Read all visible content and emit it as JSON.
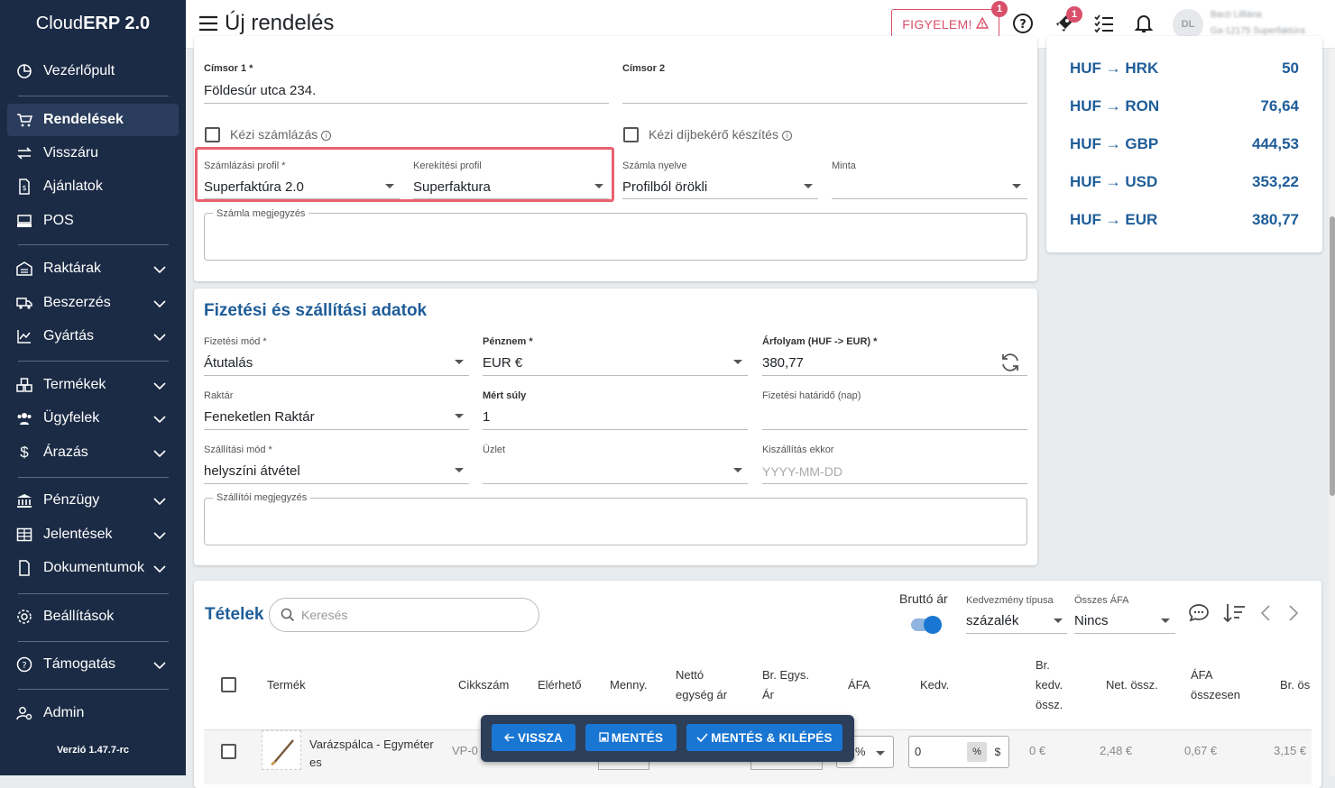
{
  "app": {
    "brand_prefix": "Cloud",
    "brand_bold": "ERP 2.0",
    "version": "Verzió 1.47.7-rc"
  },
  "sidebar": {
    "items": [
      {
        "label": "Vezérlőpult",
        "icon": "dashboard-icon"
      },
      {
        "label": "Rendelések",
        "icon": "cart-icon",
        "active": true
      },
      {
        "label": "Visszáru",
        "icon": "swap-icon"
      },
      {
        "label": "Ajánlatok",
        "icon": "document-dollar-icon"
      },
      {
        "label": "POS",
        "icon": "pos-icon"
      },
      {
        "label": "Raktárak",
        "icon": "warehouse-icon"
      },
      {
        "label": "Beszerzés",
        "icon": "truck-icon"
      },
      {
        "label": "Gyártás",
        "icon": "chart-icon"
      },
      {
        "label": "Termékek",
        "icon": "boxes-icon"
      },
      {
        "label": "Ügyfelek",
        "icon": "users-icon"
      },
      {
        "label": "Árazás",
        "icon": "dollar-icon"
      },
      {
        "label": "Pénzügy",
        "icon": "bank-icon"
      },
      {
        "label": "Jelentések",
        "icon": "table-icon"
      },
      {
        "label": "Dokumentumok",
        "icon": "file-icon"
      },
      {
        "label": "Beállítások",
        "icon": "gear-icon"
      },
      {
        "label": "Támogatás",
        "icon": "help-icon"
      },
      {
        "label": "Admin",
        "icon": "admin-icon"
      }
    ]
  },
  "header": {
    "title": "Új rendelés",
    "warning_label": "FIGYELEM!",
    "warning_badge": "1",
    "rocket_badge": "1",
    "avatar_initials": "DL",
    "user_name": "Barzi Lilliána",
    "user_sub": "Ga-12175 Superfaktúra"
  },
  "address": {
    "line1_label": "Címsor 1 *",
    "line1_value": "Földesúr utca 234.",
    "line2_label": "Címsor 2",
    "line2_value": "",
    "manual_invoice_label": "Kézi számlázás",
    "manual_proforma_label": "Kézi díjbekérő készítés",
    "billing_profile_label": "Számlázási profil *",
    "billing_profile_value": "Superfaktúra 2.0",
    "rounding_profile_label": "Kerekítési profil",
    "rounding_profile_value": "Superfaktura",
    "invoice_lang_label": "Számla nyelve",
    "invoice_lang_value": "Profilból örökli",
    "template_label": "Minta",
    "template_value": "",
    "invoice_note_label": "Számla megjegyzés"
  },
  "rates": [
    {
      "from": "HUF",
      "to": "HRK",
      "value": "50"
    },
    {
      "from": "HUF",
      "to": "RON",
      "value": "76,64"
    },
    {
      "from": "HUF",
      "to": "GBP",
      "value": "444,53"
    },
    {
      "from": "HUF",
      "to": "USD",
      "value": "353,22"
    },
    {
      "from": "HUF",
      "to": "EUR",
      "value": "380,77"
    }
  ],
  "payment": {
    "title": "Fizetési és szállítási adatok",
    "method_label": "Fizetési mód *",
    "method_value": "Átutalás",
    "currency_label": "Pénznem *",
    "currency_value": "EUR €",
    "rate_label": "Árfolyam (HUF -> EUR) *",
    "rate_value": "380,77",
    "warehouse_label": "Raktár",
    "warehouse_value": "Feneketlen Raktár",
    "weight_label": "Mért súly",
    "weight_value": "1",
    "deadline_label": "Fizetési határidő (nap)",
    "deadline_value": "",
    "shipping_label": "Szállítási mód *",
    "shipping_value": "helyszíni átvétel",
    "shop_label": "Üzlet",
    "shop_value": "",
    "delivery_label": "Kiszállítás ekkor",
    "delivery_placeholder": "YYYY-MM-DD",
    "shipping_note_label": "Szállítói megjegyzés"
  },
  "items": {
    "title": "Tételek",
    "search_placeholder": "Keresés",
    "gross_price_label": "Bruttó ár",
    "discount_type_label": "Kedvezmény típusa",
    "discount_type_value": "százalék",
    "total_vat_label": "Összes ÁFA",
    "total_vat_value": "Nincs",
    "columns": {
      "product": "Termék",
      "sku": "Cikkszám",
      "available": "Elérhető",
      "qty": "Menny.",
      "net_unit_1": "Nettó",
      "net_unit_2": "egység ár",
      "gross_unit_1": "Br. Egys.",
      "gross_unit_2": "Ár",
      "vat": "ÁFA",
      "discount": "Kedv.",
      "gross_disc_1": "Br.",
      "gross_disc_2": "kedv.",
      "gross_disc_3": "össz.",
      "net_total": "Net. össz.",
      "vat_total_1": "ÁFA",
      "vat_total_2": "összesen",
      "gross_total": "Br. ös"
    },
    "row": {
      "product_line1": "Varázspálca - Egyméter",
      "product_line2": "es",
      "sku": "VP-0",
      "vat_suffix": "%",
      "discount_value": "0",
      "pct_symbol": "%",
      "dollar_symbol": "$",
      "gross_disc": "0 €",
      "net_total": "2,48 €",
      "vat_total": "0,67 €",
      "gross_total": "3,15 €"
    }
  },
  "actions": {
    "back": "VISSZA",
    "save": "MENTÉS",
    "save_exit": "MENTÉS & KILÉPÉS"
  },
  "colors": {
    "sidebar": "#1b2b45",
    "accent": "#1f5d99",
    "button": "#1976d2",
    "highlight": "#e8636f"
  }
}
